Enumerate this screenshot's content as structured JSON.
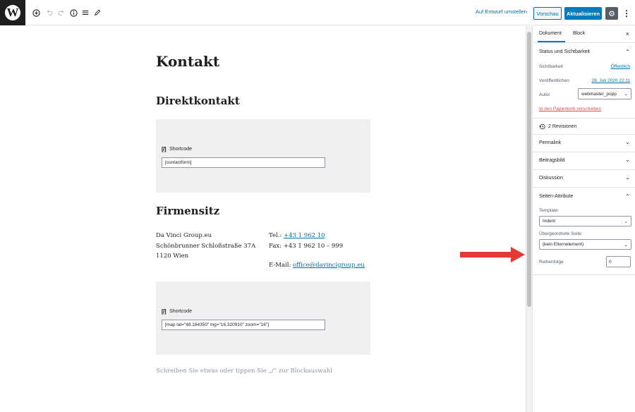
{
  "toolbar": {
    "logo": "W",
    "icons": [
      "add-block-icon",
      "undo-icon",
      "redo-icon",
      "info-icon",
      "list-view-icon",
      "tools-pencil-icon"
    ],
    "draft_link": "Auf Entwurf umstellen",
    "preview_label": "Vorschau",
    "update_label": "Aktualisieren"
  },
  "editor": {
    "title": "Kontakt",
    "heading_direct": "Direktkontakt",
    "shortcode_label": "Shortcode",
    "shortcode1_value": "[contactform]",
    "heading_hq": "Firmensitz",
    "address": [
      "Da Vinci Group.eu",
      "Schönbrunner Schloßstraße 37A",
      "1120 Wien"
    ],
    "tel_label": "Tel.: ",
    "tel_value": "+43 1 962 10",
    "fax_line": "Fax: +43 1 962 10 – 999",
    "email_label": "E-Mail: ",
    "email_value": "office@davincigroup.eu",
    "shortcode2_value": "[map lat=\"48.184350\" lng=\"16.320910\" zoom=\"16\"]",
    "placeholder": "Schreiben Sie etwas oder tippen Sie „/“ zur Blockauswahl"
  },
  "sidebar": {
    "tab_document": "Dokument",
    "tab_block": "Block",
    "close": "×",
    "status_title": "Status und Sichtbarkeit",
    "visibility_label": "Sichtbarkeit",
    "visibility_value": "Öffentlich",
    "published_label": "Veröffentlichen",
    "published_value": "28. Juli 2020 22:11",
    "author_label": "Autor",
    "author_value": "webmaster_popp",
    "trash_link": "In den Papierkorb verschieben",
    "revisions": "2 Revisionen",
    "permalink": "Permalink",
    "featured_image": "Beitragsbild",
    "discussion": "Diskussion",
    "page_attributes": "Seiten-Attribute",
    "template_label": "Template:",
    "template_value": "Indent",
    "parent_label": "Übergeordnete Seite:",
    "parent_value": "(kein Elternelement)",
    "order_label": "Reihenfolge",
    "order_value": "0"
  },
  "colors": {
    "accent": "#007cba",
    "link": "#0071a1",
    "arrow": "#e53935",
    "danger": "#d94f4f"
  }
}
